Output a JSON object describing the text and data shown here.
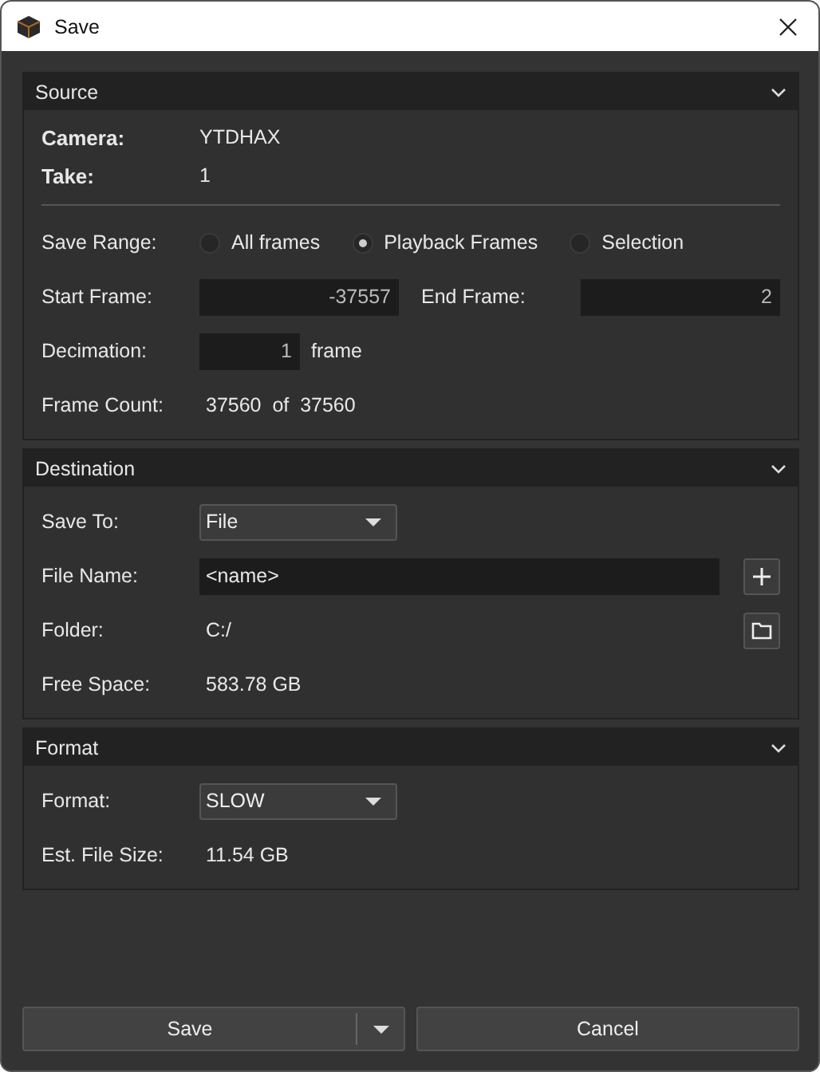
{
  "window": {
    "title": "Save"
  },
  "sections": [
    {
      "title": "Source",
      "expanded": true,
      "rows": [
        {
          "kind": "info",
          "label": "Camera:",
          "value": "YTDHAX"
        },
        {
          "kind": "info",
          "label": "Take:",
          "value": "1"
        },
        {
          "kind": "divider"
        },
        {
          "kind": "radio",
          "label": "Save Range:",
          "options": [
            {
              "label": "All frames",
              "selected": false
            },
            {
              "label": "Playback Frames",
              "selected": true
            },
            {
              "label": "Selection",
              "selected": false
            }
          ]
        },
        {
          "kind": "range",
          "label": "Start Frame:",
          "value": "-37557",
          "label2": "End Frame:",
          "value2": "2"
        },
        {
          "kind": "number",
          "label": "Decimation:",
          "value": "1",
          "unit": "frame"
        },
        {
          "kind": "text",
          "label": "Frame Count:",
          "value": "37560  of  37560"
        }
      ]
    },
    {
      "title": "Destination",
      "expanded": true,
      "rows": [
        {
          "kind": "dropdown",
          "label": "Save To:",
          "value": "File"
        },
        {
          "kind": "field",
          "label": "File Name:",
          "value": "<name>"
        },
        {
          "kind": "path",
          "label": "Folder:",
          "value": "C:/"
        },
        {
          "kind": "text",
          "label": "Free Space:",
          "value": "583.78 GB"
        }
      ]
    },
    {
      "title": "Format",
      "expanded": true,
      "rows": [
        {
          "kind": "dropdown",
          "label": "Format:",
          "value": "SLOW"
        },
        {
          "kind": "text",
          "label": "Est. File Size:",
          "value": "11.54 GB"
        }
      ]
    }
  ],
  "buttons": [
    {
      "label": "Save",
      "kind": "split"
    },
    {
      "label": "Cancel",
      "kind": "plain"
    }
  ]
}
